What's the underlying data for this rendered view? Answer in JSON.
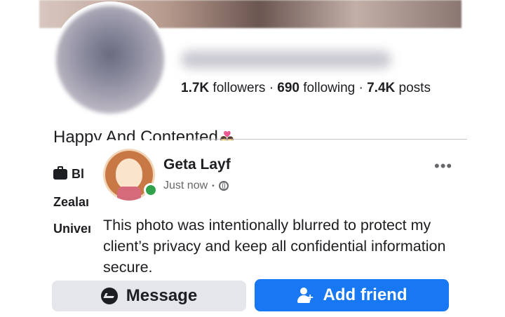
{
  "profile": {
    "followers_count": "1.7K",
    "followers_label": "followers",
    "following_count": "690",
    "following_label": "following",
    "posts_count": "7.4K",
    "posts_label": "posts",
    "separator": "·",
    "bio": "Happy And Contented",
    "intro": {
      "work": "Bl",
      "location": "Zealaı",
      "education": "Univeı"
    }
  },
  "post": {
    "author": "Geta Layf",
    "time": "Just now",
    "dot": "•",
    "more": "•••",
    "text": "This photo was intentionally blurred to protect my client’s privacy and keep all confidential information secure."
  },
  "actions": {
    "message_label": "Message",
    "add_friend_label": "Add friend"
  },
  "colors": {
    "primary": "#1877f2",
    "secondary_button": "#e4e6eb",
    "online": "#31a24c"
  },
  "icons": [
    "messenger-icon",
    "add-person-icon",
    "globe-icon",
    "briefcase-icon",
    "more-icon",
    "couple-emoji-icon"
  ]
}
